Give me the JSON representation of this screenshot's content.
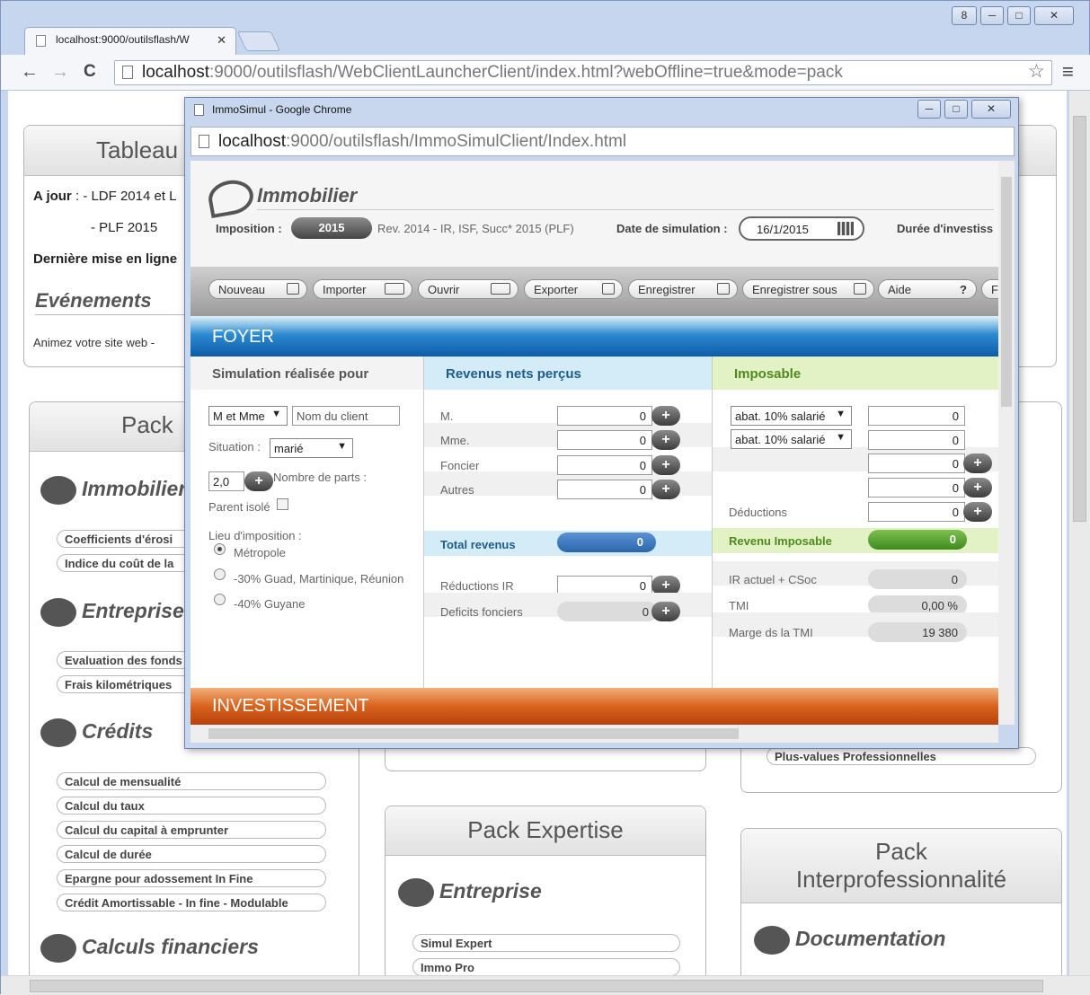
{
  "browser": {
    "tab_title": "localhost:9000/outilsflash/W",
    "tab_close": "✕",
    "url_host": "localhost",
    "url_rest": ":9000/outilsflash/WebClientLauncherClient/index.html?webOffline=true&mode=pack",
    "back": "←",
    "forward": "→",
    "reload": "C",
    "star": "☆",
    "menu": "≡",
    "win_user": "8",
    "win_min": "─",
    "win_max": "□",
    "win_close": "✕"
  },
  "background": {
    "tableau_title": "Tableau",
    "ajour_label": "A jour",
    "ajour_item1": ": - LDF 2014 et L",
    "ajour_item2": "- PLF 2015",
    "derniere_label": "Dernière mise en ligne",
    "evenements_title": "Evénements",
    "animez_text": "Animez votre site web -",
    "pack_left_title": "Pack",
    "cat_immobilier": "Immobilier",
    "cat_entreprise": "Entreprise",
    "cat_credits": "Crédits",
    "cat_calculs": "Calculs financiers",
    "immobilier_items": [
      "Coefficients d'érosi",
      "Indice du coût de la"
    ],
    "entreprise_items": [
      "Evaluation des fonds",
      "Frais kilométriques"
    ],
    "credits_items": [
      "Calcul de mensualité",
      "Calcul du taux",
      "Calcul du capital à emprunter",
      "Calcul de durée",
      "Epargne pour adossement In Fine",
      "Crédit Amortissable - In fine - Modulable"
    ],
    "plus_values": "Plus-values Professionnelles",
    "pack_expertise_title": "Pack Expertise",
    "expertise_cat": "Entreprise",
    "expertise_items": [
      "Simul Expert",
      "Immo Pro"
    ],
    "pack_inter_title_line1": "Pack",
    "pack_inter_title_line2": "Interprofessionnalité",
    "documentation_cat": "Documentation"
  },
  "popup": {
    "window_title": "ImmoSimul - Google Chrome",
    "url_host": "localhost",
    "url_rest": ":9000/outilsflash/ImmoSimulClient/Index.html",
    "win_min": "─",
    "win_max": "□",
    "win_close": "✕",
    "app": {
      "logo": "Immobilier",
      "imposition_label": "Imposition :",
      "imposition_year": "2015",
      "imposition_desc": "Rev. 2014 - IR, ISF, Succ* 2015 (PLF)",
      "date_label": "Date de simulation :",
      "date_value": "16/1/2015",
      "duree_label": "Durée d'investiss",
      "buttons": {
        "nouveau": "Nouveau",
        "importer": "Importer",
        "ouvrir": "Ouvrir",
        "exporter": "Exporter",
        "enregistrer": "Enregistrer",
        "enregistrer_sous": "Enregistrer sous",
        "aide": "Aide",
        "aide_q": "?",
        "partial": "F"
      },
      "foyer_band": "FOYER",
      "investissement_band": "INVESTISSEMENT",
      "col1": {
        "header": "Simulation réalisée pour",
        "civilite": "M et Mme",
        "client_placeholder": "Nom du client",
        "situation_label": "Situation :",
        "situation_value": "marié",
        "parts_value": "2,0",
        "parts_label": "Nombre de parts :",
        "parent_isole": "Parent isolé",
        "lieu_label": "Lieu d'imposition :",
        "lieu_options": [
          "Métropole",
          "-30% Guad, Martinique, Réunion",
          "-40% Guyane"
        ],
        "lieu_selected": 0
      },
      "col2": {
        "header": "Revenus nets perçus",
        "rows": [
          {
            "label": "M.",
            "value": "0"
          },
          {
            "label": "Mme.",
            "value": "0"
          },
          {
            "label": "Foncier",
            "value": "0"
          },
          {
            "label": "Autres",
            "value": "0"
          }
        ],
        "total_label": "Total revenus",
        "total_value": "0",
        "reductions_label": "Réductions IR",
        "reductions_value": "0",
        "deficits_label": "Deficits fonciers",
        "deficits_value": "0"
      },
      "col3": {
        "header": "Imposable",
        "abat1": "abat. 10% salarié",
        "abat2": "abat. 10% salarié",
        "values": [
          "0",
          "0",
          "0",
          "0"
        ],
        "deductions_label": "Déductions",
        "deductions_value": "0",
        "revenu_label": "Revenu Imposable",
        "revenu_value": "0",
        "ir_label": "IR actuel + CSoc",
        "ir_value": "0",
        "tmi_label": "TMI",
        "tmi_value": "0,00 %",
        "marge_label": "Marge ds la TMI",
        "marge_value": "19 380"
      }
    }
  },
  "colors": {
    "foyer_blue": "#1f74c2",
    "investissement_orange": "#d9621d",
    "revenus_header_bg": "#d4ecf7",
    "imposable_header_bg": "#e2f2c4",
    "total_pill": "#2f6db5",
    "revenu_pill": "#4e9a2a"
  }
}
